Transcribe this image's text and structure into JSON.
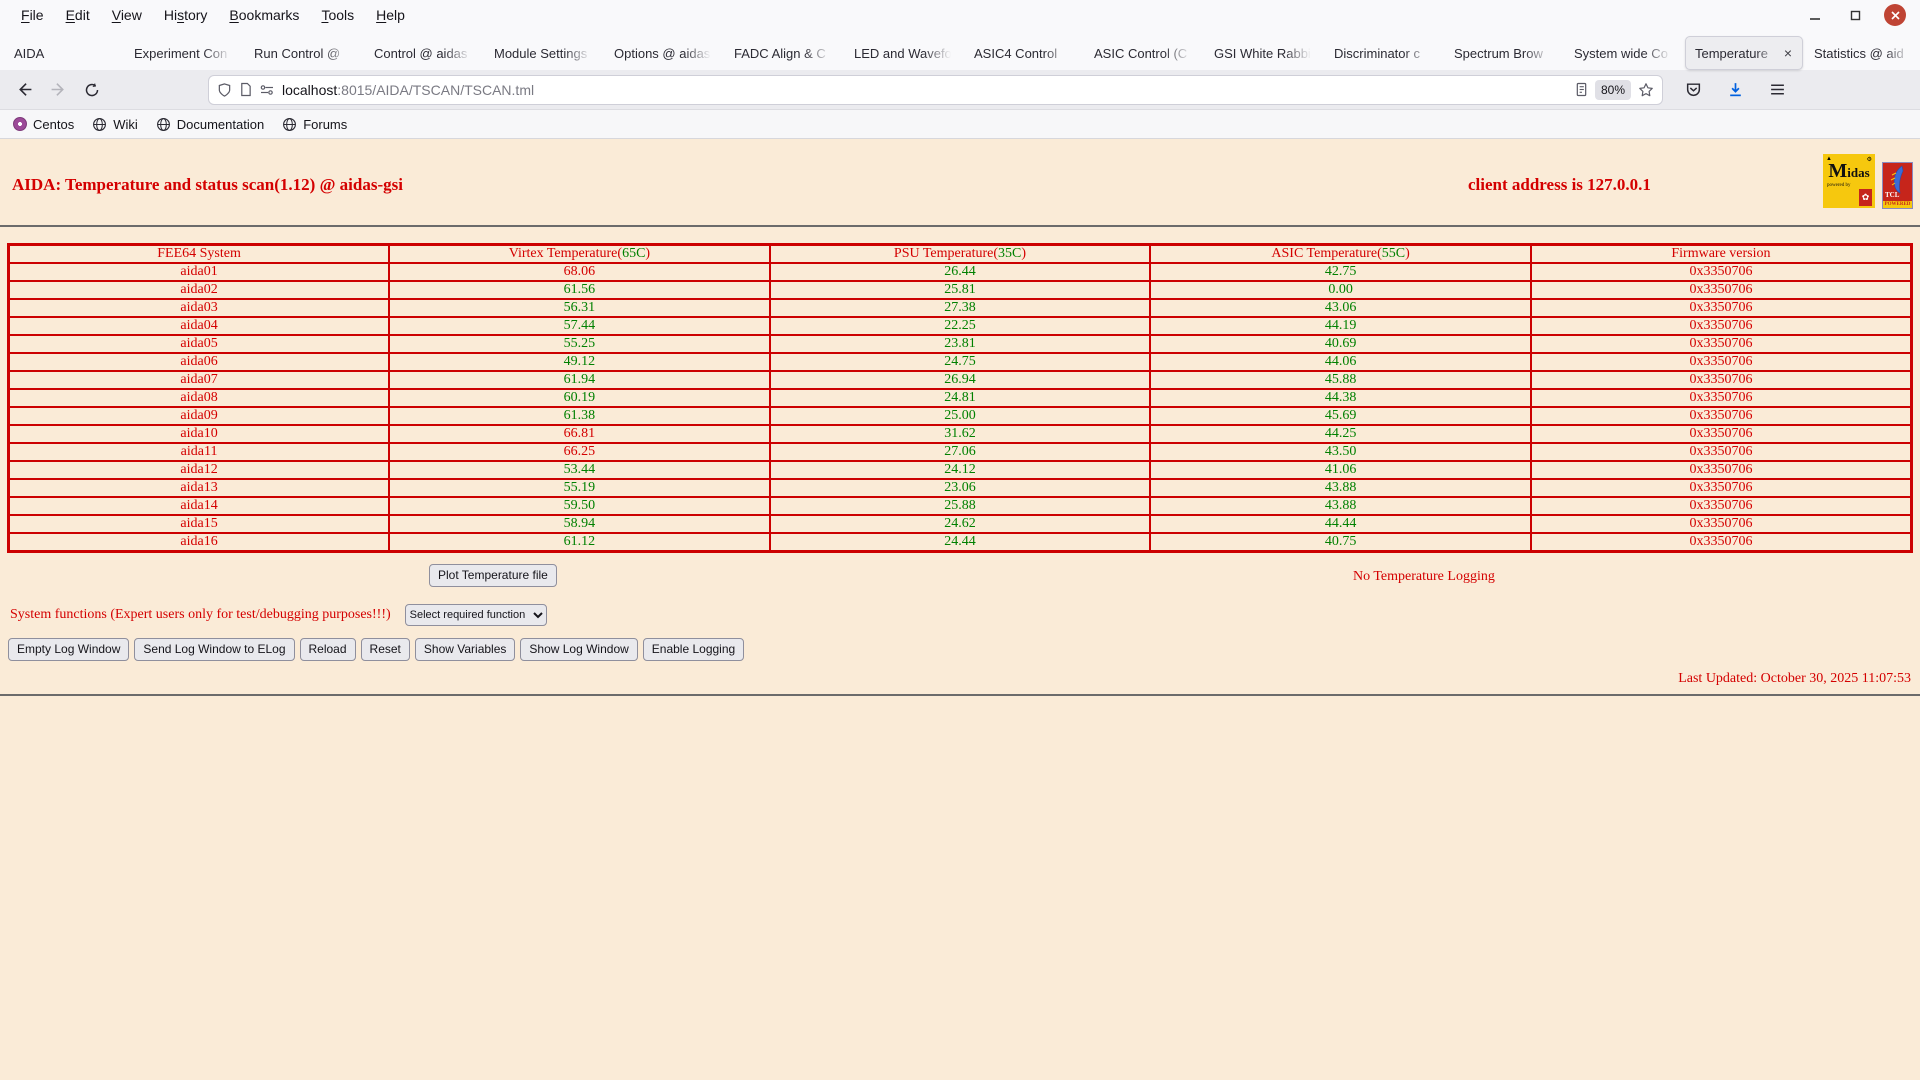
{
  "browser": {
    "menu_bar": {
      "items": [
        {
          "label": "File",
          "key": "F"
        },
        {
          "label": "Edit",
          "key": "E"
        },
        {
          "label": "View",
          "key": "V"
        },
        {
          "label": "History",
          "key": "s"
        },
        {
          "label": "Bookmarks",
          "key": "B"
        },
        {
          "label": "Tools",
          "key": "T"
        },
        {
          "label": "Help",
          "key": "H"
        }
      ]
    },
    "window_controls": [
      "minimize-icon",
      "maximize-icon",
      "close-icon"
    ],
    "tabs": [
      {
        "label": "AIDA",
        "active": false
      },
      {
        "label": "Experiment Con",
        "active": false
      },
      {
        "label": "Run Control @ ",
        "active": false
      },
      {
        "label": "Control @ aidas",
        "active": false
      },
      {
        "label": "Module Settings",
        "active": false
      },
      {
        "label": "Options @ aidas",
        "active": false
      },
      {
        "label": "FADC Align & C",
        "active": false
      },
      {
        "label": "LED and Wavefo",
        "active": false
      },
      {
        "label": "ASIC4 Control",
        "active": false
      },
      {
        "label": "ASIC Control (C",
        "active": false
      },
      {
        "label": "GSI White Rabbi",
        "active": false
      },
      {
        "label": "Discriminator c",
        "active": false
      },
      {
        "label": "Spectrum Brow",
        "active": false
      },
      {
        "label": "System wide Co",
        "active": false
      },
      {
        "label": "Temperature",
        "active": true,
        "closable": true
      },
      {
        "label": "Statistics @ aid",
        "active": false
      }
    ],
    "new_tab_label": "+",
    "url_bar": {
      "host": "localhost",
      "path": ":8015/AIDA/TSCAN/TSCAN.tml",
      "zoom_level": "80%"
    },
    "bookmarks": [
      {
        "label": "Centos",
        "icon": "centos-icon"
      },
      {
        "label": "Wiki",
        "icon": "globe-icon"
      },
      {
        "label": "Documentation",
        "icon": "globe-icon"
      },
      {
        "label": "Forums",
        "icon": "globe-icon"
      }
    ]
  },
  "page": {
    "title": "AIDA: Temperature and status scan(1.12) @ aidas-gsi",
    "client_address": "client address is 127.0.0.1",
    "logos": {
      "midas_word": "Midas",
      "midas_powered": "powered by",
      "tcl_word": "TCL",
      "tcl_powered": "POWERED"
    },
    "table": {
      "headers": [
        {
          "pre": "FEE64 System",
          "threshold": "",
          "post": ""
        },
        {
          "pre": "Virtex Temperature(",
          "threshold": "65C",
          "post": ")"
        },
        {
          "pre": "PSU Temperature(",
          "threshold": "35C",
          "post": ")"
        },
        {
          "pre": "ASIC Temperature(",
          "threshold": "55C",
          "post": ")"
        },
        {
          "pre": "Firmware version",
          "threshold": "",
          "post": ""
        }
      ],
      "rows": [
        {
          "system": "aida01",
          "virtex": "68.06",
          "virtex_alarm": true,
          "psu": "26.44",
          "psu_alarm": false,
          "asic": "42.75",
          "asic_alarm": false,
          "firmware": "0x3350706"
        },
        {
          "system": "aida02",
          "virtex": "61.56",
          "virtex_alarm": false,
          "psu": "25.81",
          "psu_alarm": false,
          "asic": "0.00",
          "asic_alarm": false,
          "firmware": "0x3350706"
        },
        {
          "system": "aida03",
          "virtex": "56.31",
          "virtex_alarm": false,
          "psu": "27.38",
          "psu_alarm": false,
          "asic": "43.06",
          "asic_alarm": false,
          "firmware": "0x3350706"
        },
        {
          "system": "aida04",
          "virtex": "57.44",
          "virtex_alarm": false,
          "psu": "22.25",
          "psu_alarm": false,
          "asic": "44.19",
          "asic_alarm": false,
          "firmware": "0x3350706"
        },
        {
          "system": "aida05",
          "virtex": "55.25",
          "virtex_alarm": false,
          "psu": "23.81",
          "psu_alarm": false,
          "asic": "40.69",
          "asic_alarm": false,
          "firmware": "0x3350706"
        },
        {
          "system": "aida06",
          "virtex": "49.12",
          "virtex_alarm": false,
          "psu": "24.75",
          "psu_alarm": false,
          "asic": "44.06",
          "asic_alarm": false,
          "firmware": "0x3350706"
        },
        {
          "system": "aida07",
          "virtex": "61.94",
          "virtex_alarm": false,
          "psu": "26.94",
          "psu_alarm": false,
          "asic": "45.88",
          "asic_alarm": false,
          "firmware": "0x3350706"
        },
        {
          "system": "aida08",
          "virtex": "60.19",
          "virtex_alarm": false,
          "psu": "24.81",
          "psu_alarm": false,
          "asic": "44.38",
          "asic_alarm": false,
          "firmware": "0x3350706"
        },
        {
          "system": "aida09",
          "virtex": "61.38",
          "virtex_alarm": false,
          "psu": "25.00",
          "psu_alarm": false,
          "asic": "45.69",
          "asic_alarm": false,
          "firmware": "0x3350706"
        },
        {
          "system": "aida10",
          "virtex": "66.81",
          "virtex_alarm": true,
          "psu": "31.62",
          "psu_alarm": false,
          "asic": "44.25",
          "asic_alarm": false,
          "firmware": "0x3350706"
        },
        {
          "system": "aida11",
          "virtex": "66.25",
          "virtex_alarm": true,
          "psu": "27.06",
          "psu_alarm": false,
          "asic": "43.50",
          "asic_alarm": false,
          "firmware": "0x3350706"
        },
        {
          "system": "aida12",
          "virtex": "53.44",
          "virtex_alarm": false,
          "psu": "24.12",
          "psu_alarm": false,
          "asic": "41.06",
          "asic_alarm": false,
          "firmware": "0x3350706"
        },
        {
          "system": "aida13",
          "virtex": "55.19",
          "virtex_alarm": false,
          "psu": "23.06",
          "psu_alarm": false,
          "asic": "43.88",
          "asic_alarm": false,
          "firmware": "0x3350706"
        },
        {
          "system": "aida14",
          "virtex": "59.50",
          "virtex_alarm": false,
          "psu": "25.88",
          "psu_alarm": false,
          "asic": "43.88",
          "asic_alarm": false,
          "firmware": "0x3350706"
        },
        {
          "system": "aida15",
          "virtex": "58.94",
          "virtex_alarm": false,
          "psu": "24.62",
          "psu_alarm": false,
          "asic": "44.44",
          "asic_alarm": false,
          "firmware": "0x3350706"
        },
        {
          "system": "aida16",
          "virtex": "61.12",
          "virtex_alarm": false,
          "psu": "24.44",
          "psu_alarm": false,
          "asic": "40.75",
          "asic_alarm": false,
          "firmware": "0x3350706"
        }
      ]
    },
    "plot_button": "Plot Temperature file",
    "logging_status": "No Temperature Logging",
    "system_functions_label": "System functions (Expert users only for test/debugging purposes!!!)",
    "function_select_value": "Select required function",
    "action_buttons": [
      "Empty Log Window",
      "Send Log Window to ELog",
      "Reload",
      "Reset",
      "Show Variables",
      "Show Log Window",
      "Enable Logging"
    ],
    "last_updated": "Last Updated: October 30, 2025 11:07:53",
    "colors": {
      "page_background": "#faebd7",
      "alarm_red": "#d40000",
      "ok_green": "#008000",
      "table_border": "#cc0000"
    }
  }
}
